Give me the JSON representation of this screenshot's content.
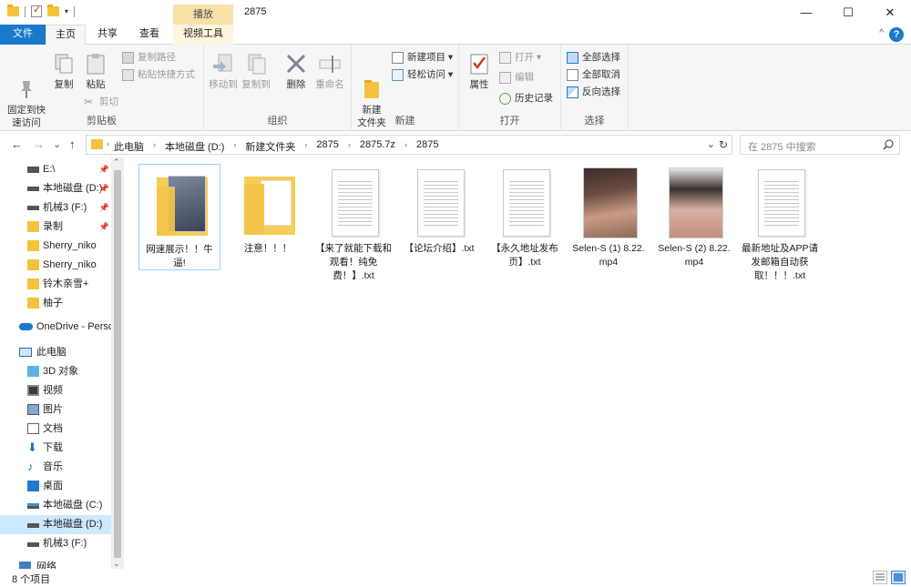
{
  "titlebar": {
    "context_tab": "播放",
    "title": "2875",
    "minimize": "—",
    "maximize": "☐",
    "close": "✕"
  },
  "tabs": {
    "file": "文件",
    "home": "主页",
    "share": "共享",
    "view": "查看",
    "video_tools": "视频工具",
    "help": "?"
  },
  "ribbon": {
    "clipboard": {
      "label": "剪贴板",
      "pin": "固定到快\n速访问",
      "copy": "复制",
      "paste": "粘贴",
      "copy_path": "复制路径",
      "paste_shortcut": "粘贴快捷方式",
      "cut": "剪切"
    },
    "organize": {
      "label": "组织",
      "move_to": "移动到",
      "copy_to": "复制到",
      "delete": "删除",
      "rename": "重命名"
    },
    "new": {
      "label": "新建",
      "new_folder": "新建\n文件夹",
      "new_item": "新建项目 ▾",
      "easy_access": "轻松访问 ▾"
    },
    "open": {
      "label": "打开",
      "properties": "属性",
      "open": "打开 ▾",
      "edit": "编辑",
      "history": "历史记录"
    },
    "select": {
      "label": "选择",
      "select_all": "全部选择",
      "select_none": "全部取消",
      "invert": "反向选择"
    }
  },
  "nav": {
    "back": "←",
    "forward": "→",
    "recent": "⌄",
    "up": "↑",
    "breadcrumbs": [
      "此电脑",
      "本地磁盘 (D:)",
      "新建文件夹",
      "2875",
      "2875.7z",
      "2875"
    ],
    "search_placeholder": "在 2875 中搜索"
  },
  "sidebar": {
    "items": [
      {
        "label": "E:\\",
        "pinned": true
      },
      {
        "label": "本地磁盘 (D:)",
        "pinned": true
      },
      {
        "label": "机械3 (F:)",
        "pinned": true
      },
      {
        "label": "录制",
        "pinned": true
      },
      {
        "label": "Sherry_niko",
        "pinned": false
      },
      {
        "label": "Sherry_niko",
        "pinned": false
      },
      {
        "label": "铃木亲雪+",
        "pinned": false
      },
      {
        "label": "柚子",
        "pinned": false
      },
      {
        "label": "OneDrive - Perso",
        "pinned": false
      },
      {
        "label": "此电脑",
        "pinned": false
      },
      {
        "label": "3D 对象",
        "pinned": false
      },
      {
        "label": "视频",
        "pinned": false
      },
      {
        "label": "图片",
        "pinned": false
      },
      {
        "label": "文档",
        "pinned": false
      },
      {
        "label": "下载",
        "pinned": false
      },
      {
        "label": "音乐",
        "pinned": false
      },
      {
        "label": "桌面",
        "pinned": false
      },
      {
        "label": "本地磁盘 (C:)",
        "pinned": false
      },
      {
        "label": "本地磁盘 (D:)",
        "pinned": false
      },
      {
        "label": "机械3 (F:)",
        "pinned": false
      },
      {
        "label": "网络",
        "pinned": false
      }
    ],
    "pin_glyph": "📌"
  },
  "files": [
    {
      "name": "网速展示！！牛逼!",
      "type": "folder-preview"
    },
    {
      "name": "注意！！！",
      "type": "folder"
    },
    {
      "name": "【来了就能下载和观看！纯免费！】.txt",
      "type": "txt"
    },
    {
      "name": "【论坛介绍】.txt",
      "type": "txt"
    },
    {
      "name": "【永久地址发布页】.txt",
      "type": "txt"
    },
    {
      "name": "Selen-S (1) 8.22.mp4",
      "type": "video"
    },
    {
      "name": "Selen-S (2) 8.22.mp4",
      "type": "video"
    },
    {
      "name": "最新地址及APP请发邮箱自动获取！！！.txt",
      "type": "txt"
    }
  ],
  "status": {
    "count": "8 个项目"
  }
}
